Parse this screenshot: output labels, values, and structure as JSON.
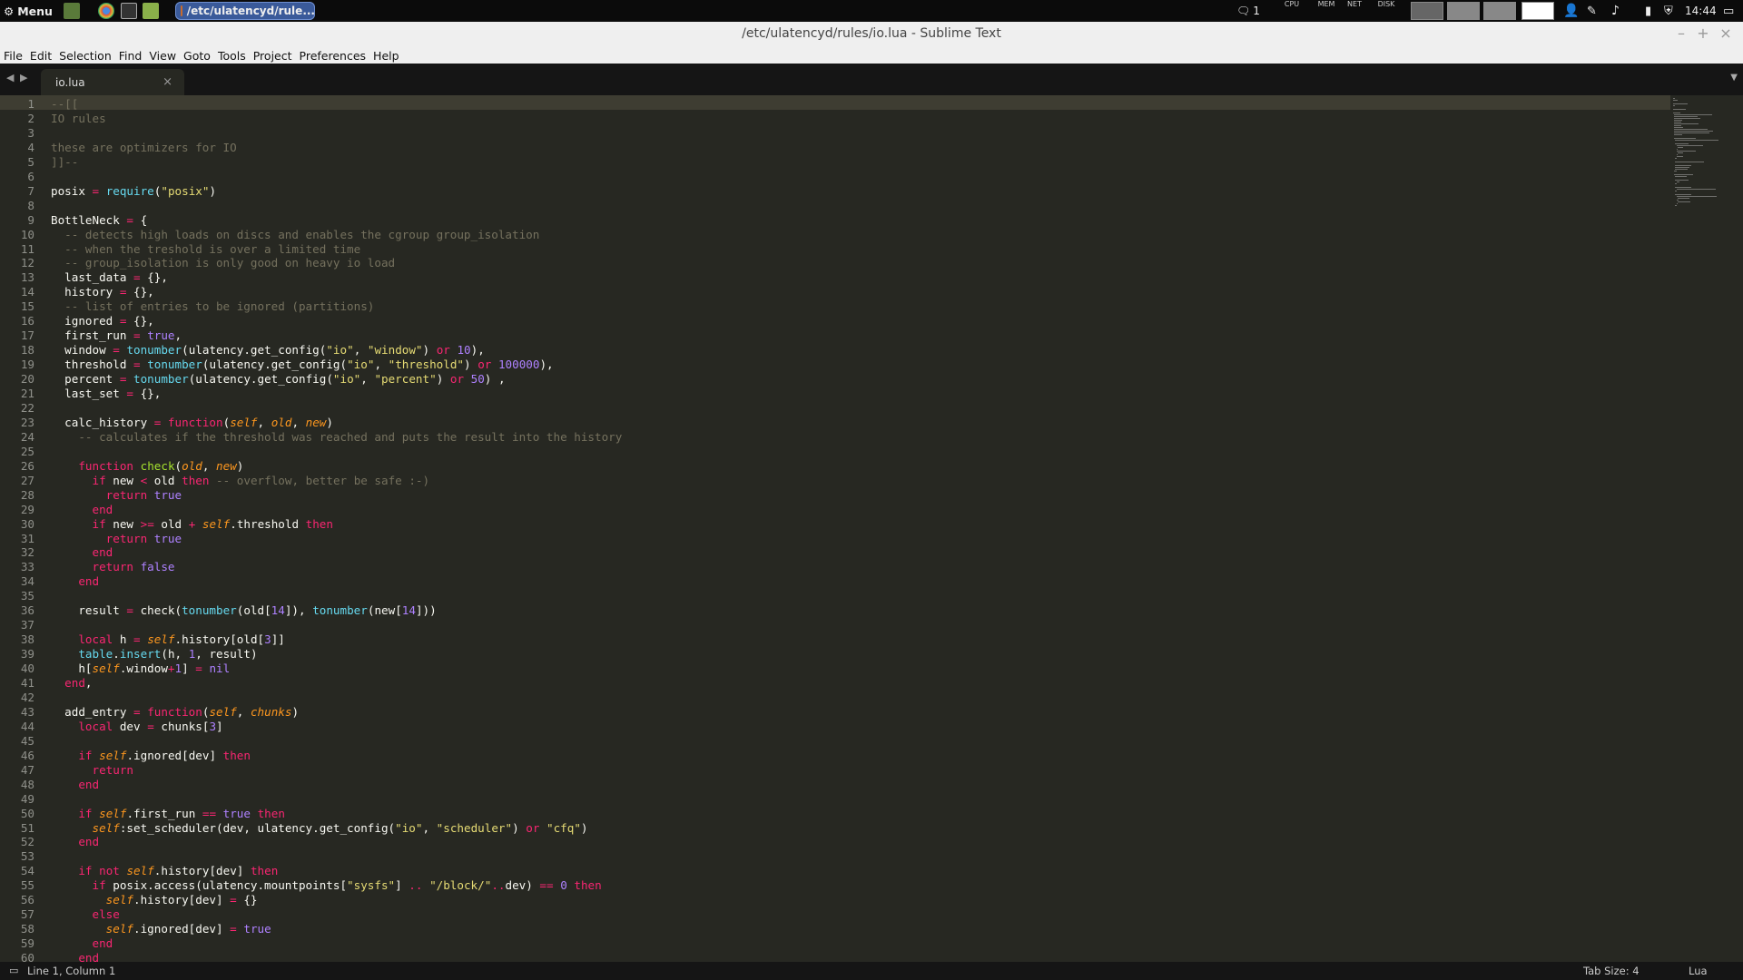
{
  "panel": {
    "menu_label": "Menu",
    "task_label": "/etc/ulatencyd/rule...",
    "notify_count": "1",
    "monitors": [
      "CPU",
      "MEM",
      "NET",
      "DISK"
    ],
    "clock": "14:44"
  },
  "window": {
    "title": "/etc/ulatencyd/rules/io.lua - Sublime Text",
    "controls": [
      "–",
      "+",
      "×"
    ]
  },
  "menubar": [
    "File",
    "Edit",
    "Selection",
    "Find",
    "View",
    "Goto",
    "Tools",
    "Project",
    "Preferences",
    "Help"
  ],
  "tab": {
    "label": "io.lua",
    "close": "×"
  },
  "editor": {
    "language": "lua",
    "lines": [
      "--[[",
      "IO rules",
      "",
      "these are optimizers for IO",
      "]]--",
      "",
      "posix = require(\"posix\")",
      "",
      "BottleNeck = {",
      "  -- detects high loads on discs and enables the cgroup group_isolation",
      "  -- when the treshold is over a limited time",
      "  -- group_isolation is only good on heavy io load",
      "  last_data = {},",
      "  history = {},",
      "  -- list of entries to be ignored (partitions)",
      "  ignored = {},",
      "  first_run = true,",
      "  window = tonumber(ulatency.get_config(\"io\", \"window\") or 10),",
      "  threshold = tonumber(ulatency.get_config(\"io\", \"threshold\") or 100000),",
      "  percent = tonumber(ulatency.get_config(\"io\", \"percent\") or 50) ,",
      "  last_set = {},",
      "",
      "  calc_history = function(self, old, new)",
      "    -- calculates if the threshold was reached and puts the result into the history",
      "",
      "    function check(old, new)",
      "      if new < old then -- overflow, better be safe :-)",
      "        return true",
      "      end",
      "      if new >= old + self.threshold then",
      "        return true",
      "      end",
      "      return false",
      "    end",
      "",
      "    result = check(tonumber(old[14]), tonumber(new[14]))",
      "",
      "    local h = self.history[old[3]]",
      "    table.insert(h, 1, result)",
      "    h[self.window+1] = nil",
      "  end,",
      "",
      "  add_entry = function(self, chunks)",
      "    local dev = chunks[3]",
      "",
      "    if self.ignored[dev] then",
      "      return",
      "    end",
      "",
      "    if self.first_run == true then",
      "      self:set_scheduler(dev, ulatency.get_config(\"io\", \"scheduler\") or \"cfq\")",
      "    end",
      "",
      "    if not self.history[dev] then",
      "      if posix.access(ulatency.mountpoints[\"sysfs\"] .. \"/block/\"..dev) == 0 then",
      "        self.history[dev] = {}",
      "      else",
      "        self.ignored[dev] = true",
      "      end",
      "    end"
    ]
  },
  "statusbar": {
    "position": "Line 1, Column 1",
    "tab_size": "Tab Size: 4",
    "syntax": "Lua"
  },
  "colors": {
    "background": "#272822",
    "comment": "#75715e",
    "keyword": "#f92672",
    "string": "#e6db74",
    "number": "#ae81ff",
    "builtin": "#66d9ef",
    "param": "#fd971f",
    "function_name": "#a6e22e"
  }
}
